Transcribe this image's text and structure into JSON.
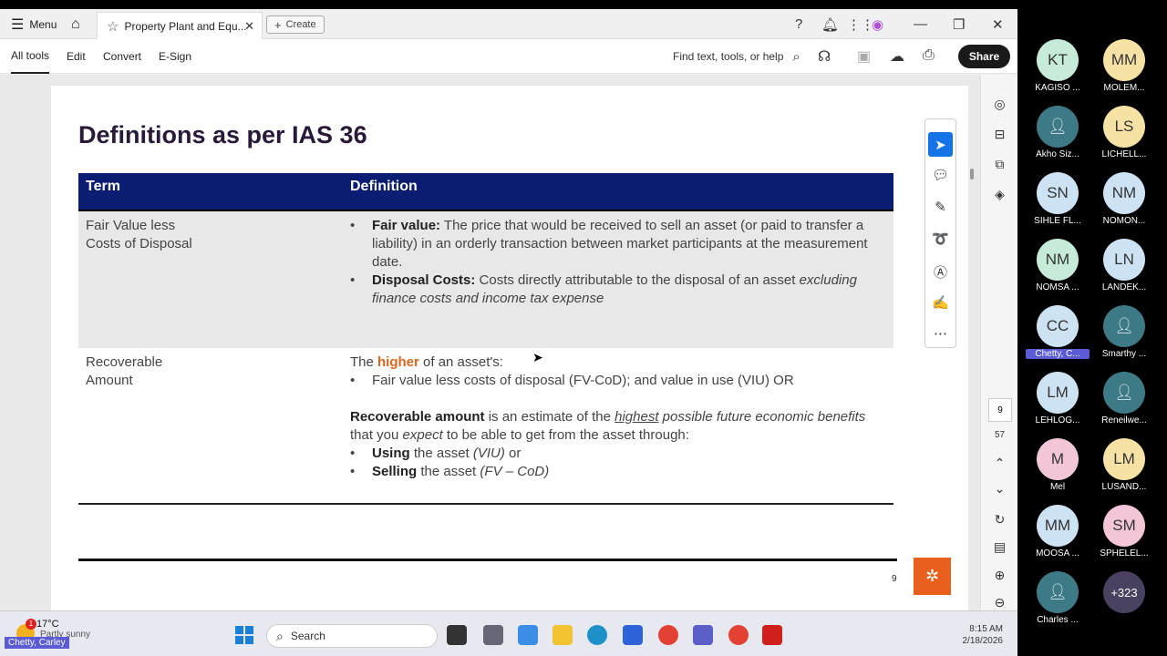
{
  "topbar": {
    "menu_label": "Menu",
    "tab_title": "Property Plant and Equ...",
    "create_label": "Create"
  },
  "toolbar": {
    "tabs": [
      "All tools",
      "Edit",
      "Convert",
      "E-Sign"
    ],
    "find_placeholder": "Find text, tools, or help",
    "share_label": "Share"
  },
  "slide": {
    "title": "Definitions as per IAS 36",
    "header_term": "Term",
    "header_definition": "Definition",
    "row1_term": "Fair Value less\nCosts of Disposal",
    "fv_label": "Fair value:",
    "fv_text": " The price that would be received to sell an asset (or paid to transfer a  liability) in an orderly transaction between market participants at the measurement  date.",
    "dc_label": "Disposal Costs:",
    "dc_text": " Costs directly attributable to the disposal of an asset ",
    "dc_italic": "excluding finance costs and income tax expense",
    "row2_term": "Recoverable\nAmount",
    "ra_the": "The ",
    "ra_higher": "higher",
    "ra_of": " of an asset's:",
    "ra_bullet": "Fair value less costs of disposal (FV-CoD); and value in use (VIU)  OR",
    "ra_bold": "Recoverable amount",
    "ra_is": " is an estimate of the ",
    "ra_highest": "highest",
    "ra_possible": " possible future economic benefits",
    "ra_that": " that  you ",
    "ra_expect": "expect",
    "ra_rest": " to be able to get from the asset through:",
    "using_b": "Using",
    "using_t": " the asset ",
    "using_i": "(VIU)",
    "using_or": " or",
    "selling_b": "Selling",
    "selling_t": " the asset ",
    "selling_i": "(FV – CoD)",
    "page_number": "9"
  },
  "rail": {
    "current_page": "9",
    "total_pages": "57"
  },
  "taskbar": {
    "temp": "17°C",
    "condition": "Partly sunny",
    "badge": "1",
    "search_label": "Search",
    "time": "8:15 AM",
    "date": "2/18/2026"
  },
  "presenter": "Chetty, Carley",
  "participants": [
    {
      "initials": "KT",
      "name": "KAGISO ...",
      "color": "#c6ecd9"
    },
    {
      "initials": "MM",
      "name": "MOLEM...",
      "color": "#f6e2a4"
    },
    {
      "initials": "",
      "name": "Akho Siz...",
      "color": "#3d7a86"
    },
    {
      "initials": "LS",
      "name": "LICHELL...",
      "color": "#f6e2a4"
    },
    {
      "initials": "SN",
      "name": "SIHLE FL...",
      "color": "#cde3f3"
    },
    {
      "initials": "NM",
      "name": "NOMON...",
      "color": "#cde3f3"
    },
    {
      "initials": "NM",
      "name": "NOMSA ...",
      "color": "#c6ecd9"
    },
    {
      "initials": "LN",
      "name": "LANDEK...",
      "color": "#cde3f3"
    },
    {
      "initials": "CC",
      "name": "Chetty, C...",
      "color": "#cde3f3"
    },
    {
      "initials": "",
      "name": "Smarthy ...",
      "color": "#3d7a86"
    },
    {
      "initials": "LM",
      "name": "LEHLOG...",
      "color": "#cde3f3"
    },
    {
      "initials": "",
      "name": "Reneilwe...",
      "color": "#3d7a86"
    },
    {
      "initials": "M",
      "name": "Mel",
      "color": "#f2c6d8"
    },
    {
      "initials": "LM",
      "name": "LUSAND...",
      "color": "#f6e2a4"
    },
    {
      "initials": "MM",
      "name": "MOOSA ...",
      "color": "#cde3f3"
    },
    {
      "initials": "SM",
      "name": "SPHELEL...",
      "color": "#f2c6d8"
    },
    {
      "initials": "",
      "name": "Charles ...",
      "color": "#3d7a86"
    },
    {
      "initials": "+323",
      "name": "",
      "color": "#4a4060"
    }
  ]
}
